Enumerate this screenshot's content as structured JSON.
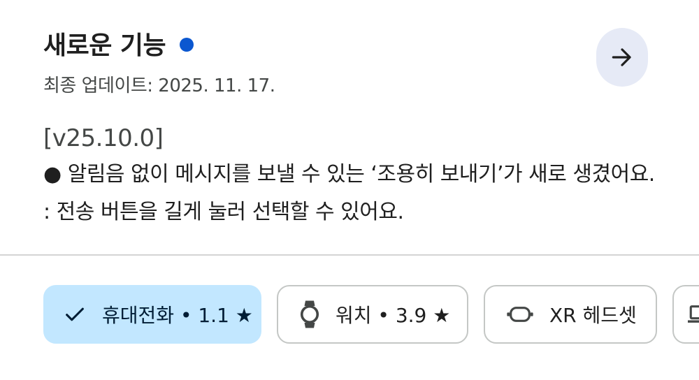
{
  "header": {
    "title": "새로운 기능",
    "updated": "최종 업데이트: 2025. 11. 17."
  },
  "release_notes": {
    "version": "[v25.10.0]",
    "line1": "● 알림음 없이 메시지를 보낼 수 있는 ‘조용히 보내기’가 새로 생겼어요.",
    "line2": ": 전송 버튼을 길게 눌러 선택할 수 있어요."
  },
  "device_chips": [
    {
      "label": "휴대전화 • 1.1 ★",
      "icon": "check-icon",
      "selected": true
    },
    {
      "label": "워치 • 3.9 ★",
      "icon": "watch-icon",
      "selected": false
    },
    {
      "label": "XR 헤드셋",
      "icon": "vr-headset-icon",
      "selected": false
    },
    {
      "label": "",
      "icon": "laptop-icon",
      "selected": false
    }
  ],
  "colors": {
    "accent_dot": "#0b57d0",
    "selected_chip": "#c2e7ff",
    "arrow_button_bg": "#e6eaf6"
  }
}
